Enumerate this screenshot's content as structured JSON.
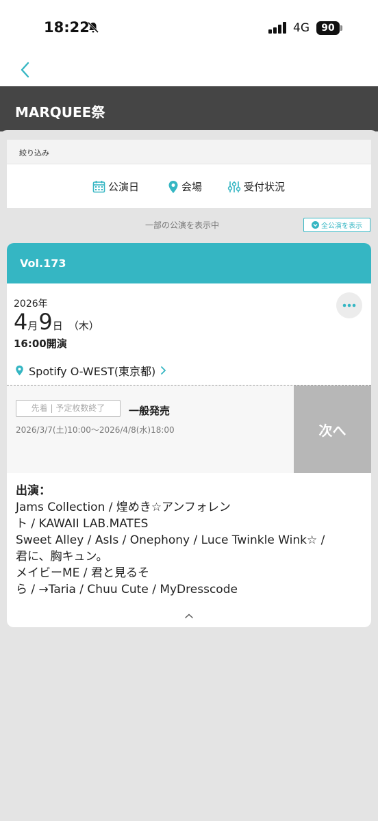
{
  "status_bar": {
    "time": "18:22",
    "network": "4G",
    "battery": "90",
    "icons": [
      "bell-slash-icon",
      "signal-icon",
      "battery-icon"
    ]
  },
  "nav": {
    "back_icon": "chevron-left-icon"
  },
  "header": {
    "title": "MARQUEE祭"
  },
  "filter": {
    "label": "絞り込み",
    "options": [
      {
        "label": "公演日",
        "icon": "calendar-icon"
      },
      {
        "label": "会場",
        "icon": "location-pin-icon"
      },
      {
        "label": "受付状況",
        "icon": "sliders-icon"
      }
    ]
  },
  "list_status": {
    "partial_text": "一部の公演を表示中",
    "show_all_label": "全公演を表示"
  },
  "event": {
    "vol": "Vol.173",
    "year": "2026年",
    "month": "4",
    "month_unit": "月",
    "day": "9",
    "day_unit": "日",
    "weekday": "（木）",
    "open_time": "16:00開演",
    "venue": "Spotify O-WEST(東京都)",
    "sale_badge": "先着 | 予定枚数終了",
    "sale_type": "一般発売",
    "sale_period": "2026/3/7(土)10:00～2026/4/8(水)18:00",
    "next_label": "次へ",
    "performers_label": "出演：",
    "performers_lines": [
      "Jams Collection / 煌めき☆アンフォレン",
      "ト / KAWAII LAB.MATES",
      "Sweet Alley / AsIs / Onephony /  Luce Twinkle Wink☆ /",
      "君に、胸キュン。",
      "メイビーME / 君と見るそ",
      "ら / →Taria / Chuu Cute /  MyDresscode"
    ]
  },
  "colors": {
    "accent": "#35b6c3",
    "header_bg": "#454545",
    "next_button": "#b7b7b7",
    "background": "#e4e4e4"
  }
}
